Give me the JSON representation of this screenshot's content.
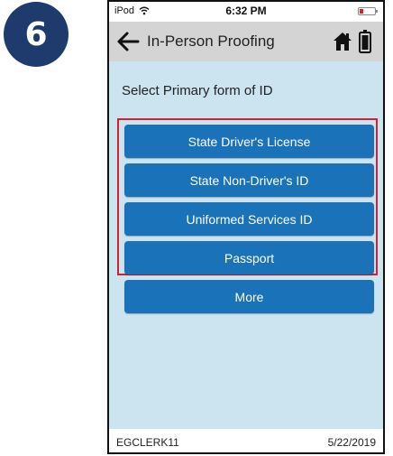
{
  "step": {
    "number": "6"
  },
  "status_bar": {
    "device": "iPod",
    "time": "6:32 PM",
    "battery_color": "#e02020"
  },
  "nav": {
    "title": "In-Person Proofing",
    "icons": [
      "back-arrow-icon",
      "home-icon",
      "battery-icon"
    ]
  },
  "content": {
    "prompt": "Select Primary form of ID",
    "highlight_color": "#d8202a",
    "button_color": "#1a73b9",
    "options": [
      {
        "label": "State Driver's License"
      },
      {
        "label": "State Non-Driver's ID"
      },
      {
        "label": "Uniformed Services ID"
      },
      {
        "label": "Passport"
      }
    ],
    "more_label": "More"
  },
  "footer": {
    "user": "EGCLERK11",
    "date": "5/22/2019"
  }
}
